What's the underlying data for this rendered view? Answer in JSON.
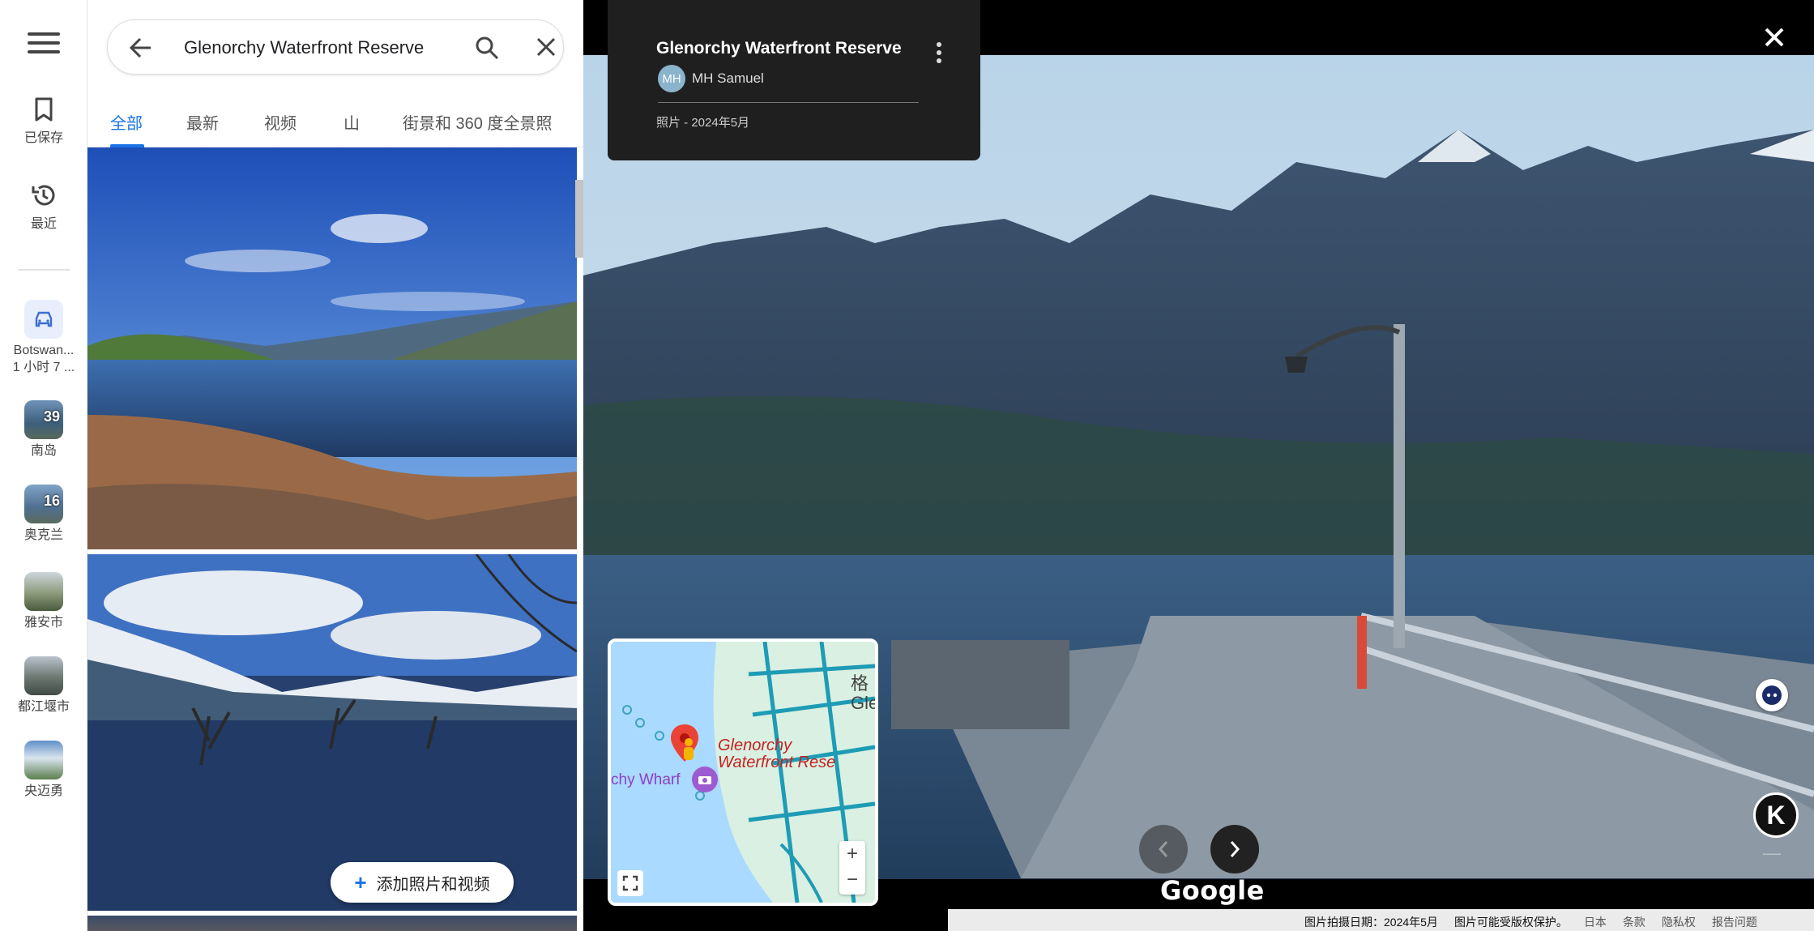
{
  "rail": {
    "saved_label": "已保存",
    "recent_label": "最近",
    "recents": [
      {
        "label1": "Botswan...",
        "label2": "1 小时 7 ..."
      },
      {
        "label1": "南岛",
        "count": "39"
      },
      {
        "label1": "奥克兰",
        "count": "16"
      },
      {
        "label1": "雅安市"
      },
      {
        "label1": "都江堰市"
      },
      {
        "label1": "央迈勇"
      }
    ]
  },
  "search": {
    "value": "Glenorchy Waterfront Reserve"
  },
  "tabs": [
    "全部",
    "最新",
    "视频",
    "山",
    "街景和 360 度全景照"
  ],
  "add_button_label": "添加照片和视频",
  "infocard": {
    "title": "Glenorchy Waterfront Reserve",
    "avatar_initials": "MH",
    "author": "MH Samuel",
    "date": "照片 - 2024年5月"
  },
  "minimap": {
    "place_label_line1": "Glenorchy",
    "place_label_line2": "Waterfront Rese",
    "wharf_label": "chy Wharf",
    "town_label_line1": "格",
    "town_label_line2": "Gle"
  },
  "viewer": {
    "brand": "Google",
    "k_badge": "K"
  },
  "footer": {
    "capture_date": "图片拍摄日期：2024年5月",
    "copyright": "图片可能受版权保护。",
    "region": "日本",
    "terms": "条款",
    "privacy": "隐私权",
    "report": "报告问题"
  },
  "colors": {
    "accent": "#1a73e8",
    "pin": "#ea4335",
    "viewer_bg": "#000000"
  }
}
